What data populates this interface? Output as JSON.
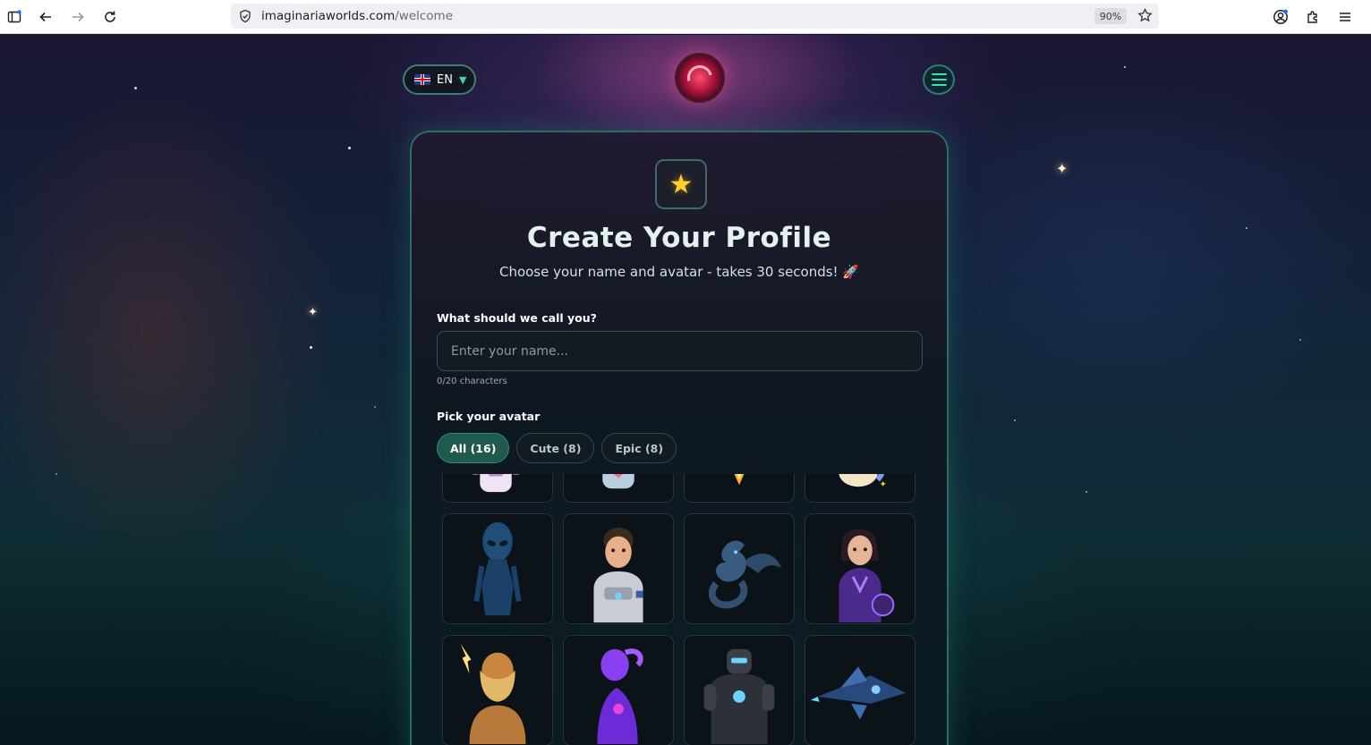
{
  "browser": {
    "url_domain": "imaginariaworlds.com",
    "url_path": "/welcome",
    "zoom": "90%"
  },
  "header": {
    "language": "EN"
  },
  "profile": {
    "title": "Create Your Profile",
    "subtitle": "Choose your name and avatar - takes 30 seconds! 🚀",
    "name_label": "What should we call you?",
    "name_placeholder": "Enter your name...",
    "name_value": "",
    "char_count": "0/20 characters",
    "avatar_label": "Pick your avatar",
    "filters": [
      {
        "label": "All (16)",
        "active": true
      },
      {
        "label": "Cute (8)",
        "active": false
      },
      {
        "label": "Epic (8)",
        "active": false
      }
    ],
    "avatars": [
      {
        "name": "astronaut-girl-avatar"
      },
      {
        "name": "robot-avatar"
      },
      {
        "name": "rocket-avatar"
      },
      {
        "name": "unicorn-avatar"
      },
      {
        "name": "alien-avatar"
      },
      {
        "name": "astronaut-boy-avatar"
      },
      {
        "name": "dragon-avatar"
      },
      {
        "name": "space-heroine-avatar"
      },
      {
        "name": "thunder-god-avatar"
      },
      {
        "name": "cosmic-spirit-avatar"
      },
      {
        "name": "armored-robot-avatar"
      },
      {
        "name": "spaceship-avatar"
      }
    ]
  },
  "colors": {
    "accent": "#2f8d78",
    "accent_active_bg": "#1f5a4c",
    "card_border": "#2c6d63",
    "star": "#ffcf2e"
  }
}
